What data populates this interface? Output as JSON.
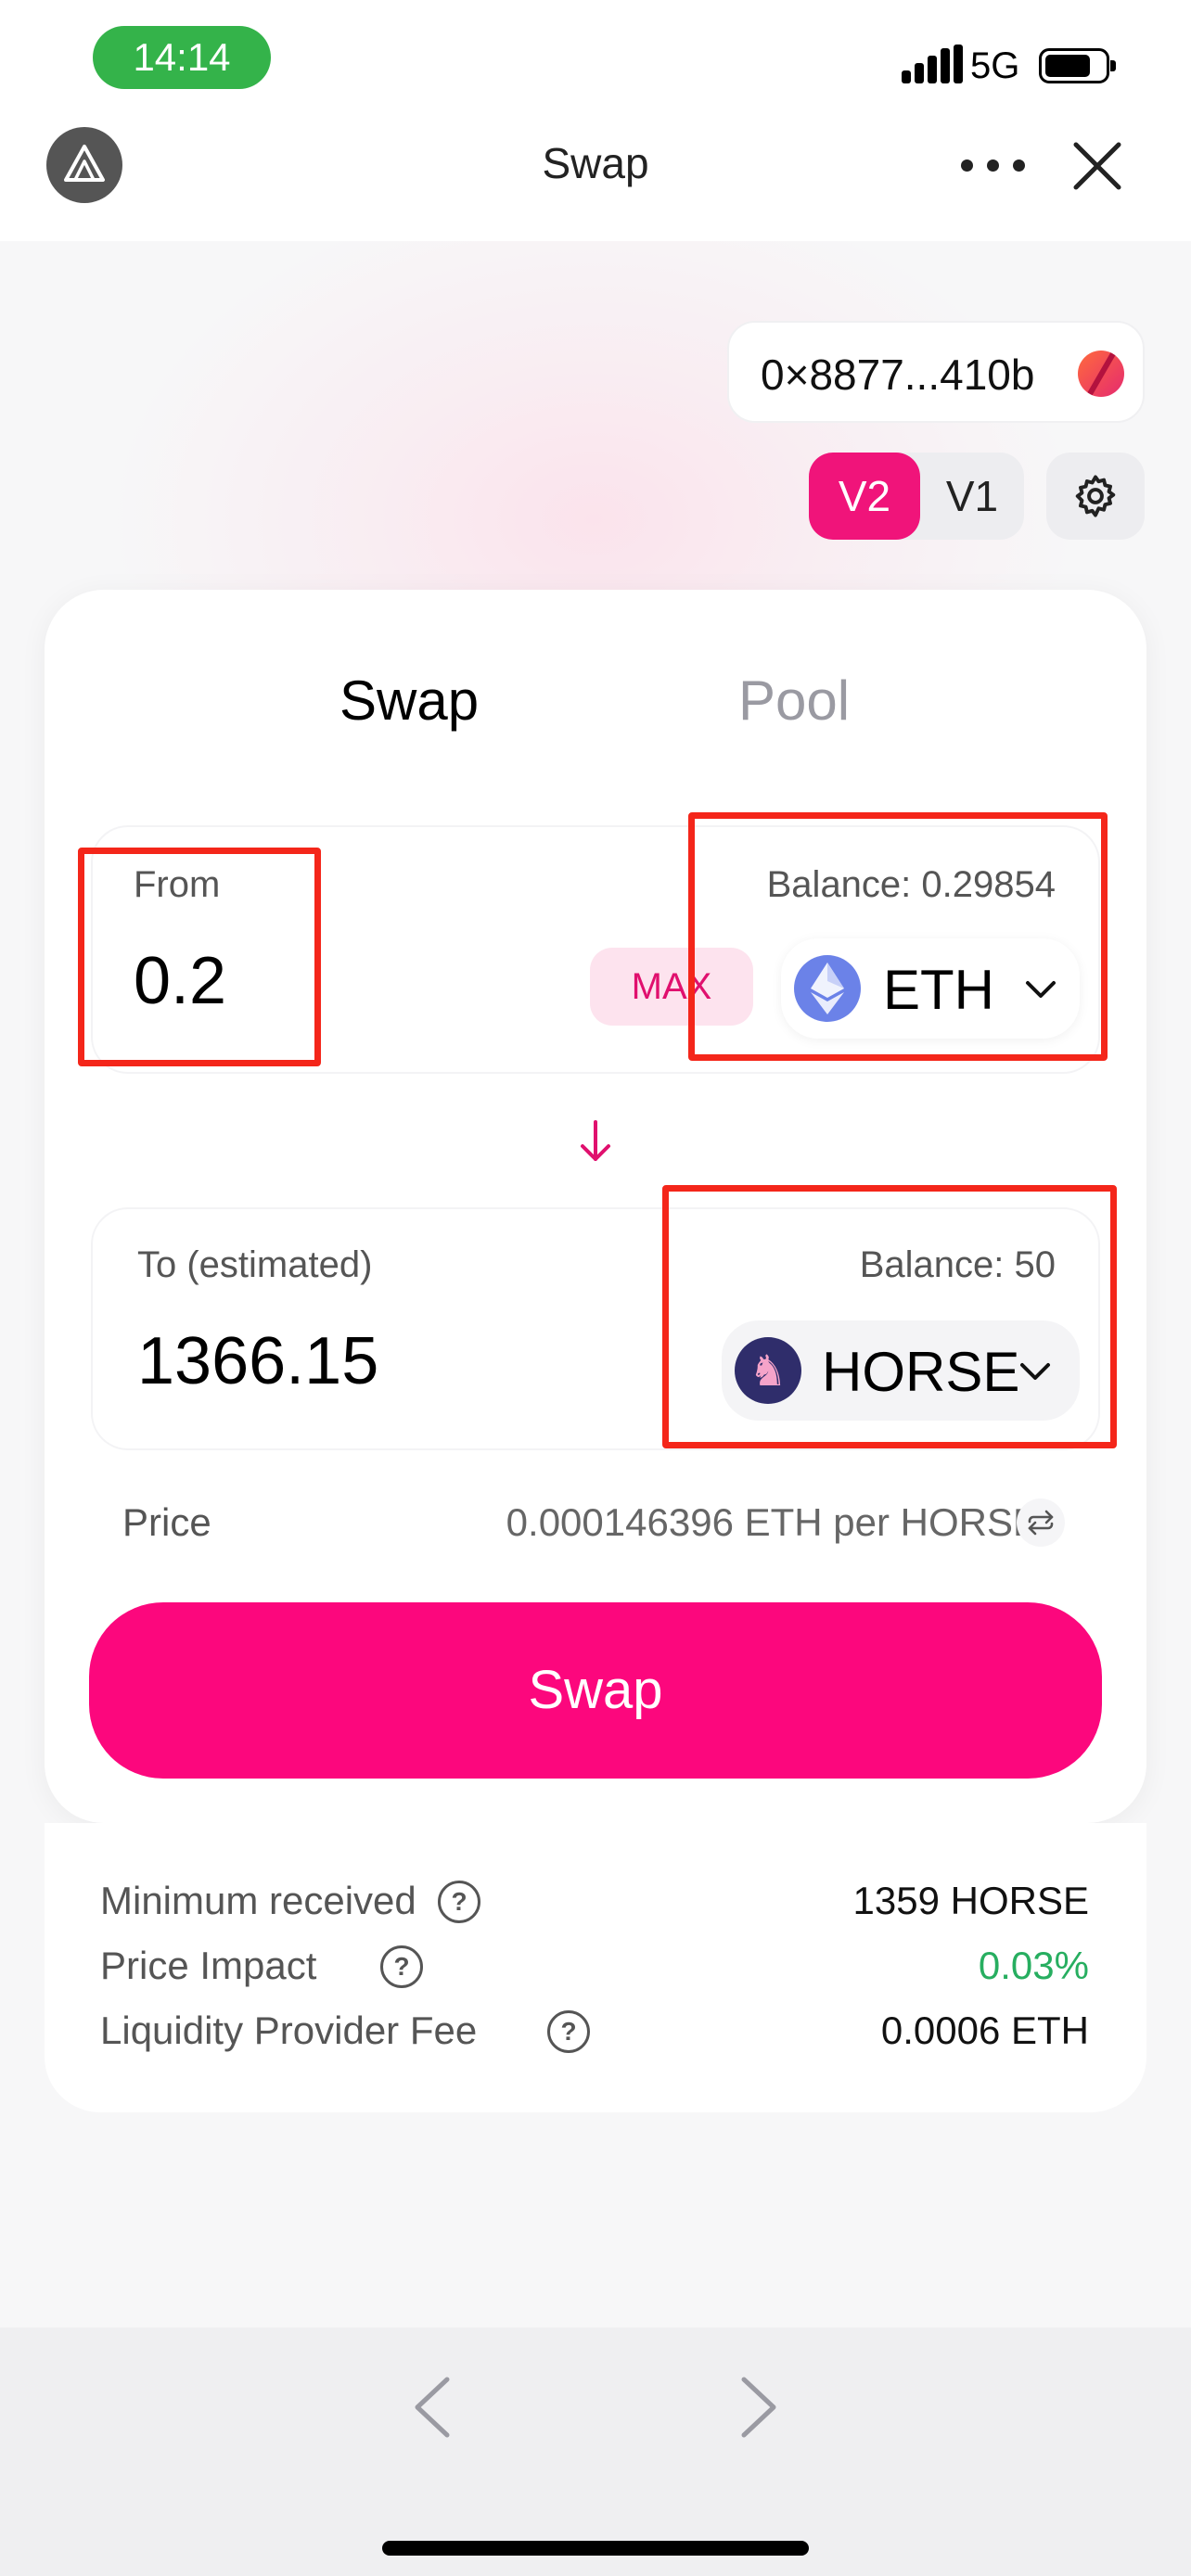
{
  "status_bar": {
    "time": "14:14",
    "network": "5G"
  },
  "nav": {
    "title": "Swap"
  },
  "wallet": {
    "address": "0×8877...410b"
  },
  "version": {
    "v2_label": "V2",
    "v1_label": "V1",
    "selected": "V2"
  },
  "tabs": [
    {
      "label": "Swap",
      "active": true
    },
    {
      "label": "Pool",
      "active": false
    }
  ],
  "from": {
    "label": "From",
    "amount": "0.2",
    "max_label": "MAX",
    "balance": "Balance: 0.29854",
    "token": "ETH",
    "token_icon": "ethereum-icon"
  },
  "to": {
    "label": "To (estimated)",
    "amount": "1366.15",
    "balance": "Balance: 50",
    "token": "HORSE",
    "token_icon": "horse-icon"
  },
  "price": {
    "label": "Price",
    "value": "0.000146396 ETH per HORSE"
  },
  "swap_button": "Swap",
  "details": [
    {
      "label": "Minimum received",
      "value": "1359 HORSE"
    },
    {
      "label": "Price Impact",
      "value": "0.03%"
    },
    {
      "label": "Liquidity Provider Fee",
      "value": "0.0006 ETH"
    }
  ],
  "colors": {
    "accent": "#fc077d",
    "version_active": "#f0147a",
    "status_time_bg": "#34b34a",
    "price_impact": "#27ae60",
    "highlight_box": "#f4261a"
  }
}
